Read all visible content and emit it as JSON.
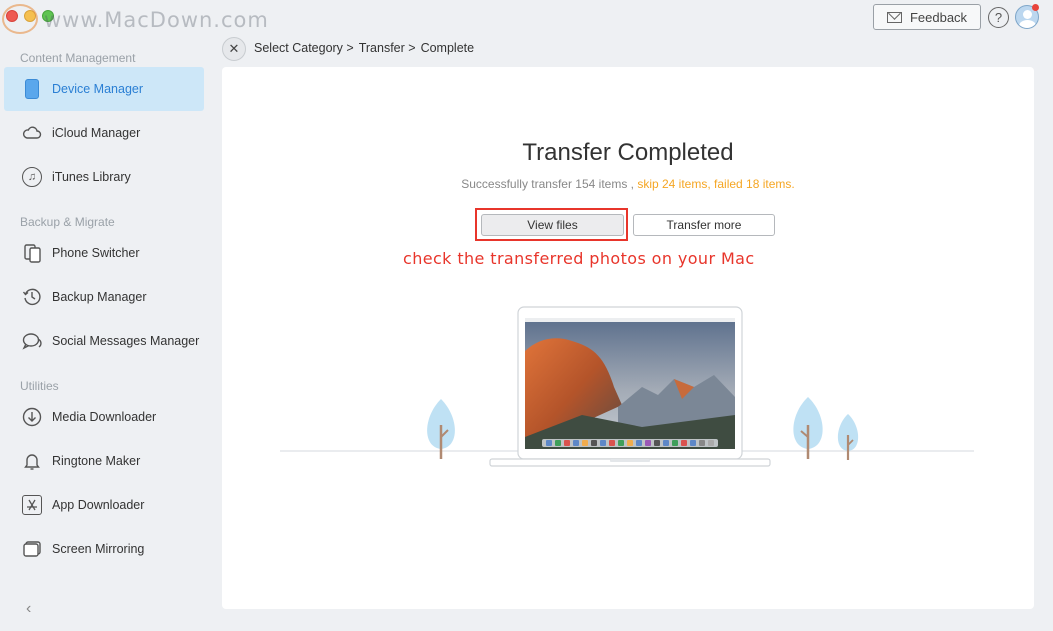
{
  "watermark": "www.MacDown.com",
  "header": {
    "feedback_label": "Feedback",
    "help_label": "?"
  },
  "sidebar": {
    "sections": [
      {
        "label": "Content Management",
        "items": [
          {
            "label": "Device Manager",
            "icon": "phone-icon",
            "active": true
          },
          {
            "label": "iCloud Manager",
            "icon": "cloud-icon"
          },
          {
            "label": "iTunes Library",
            "icon": "music-note-icon"
          }
        ]
      },
      {
        "label": "Backup & Migrate",
        "items": [
          {
            "label": "Phone Switcher",
            "icon": "phone-switch-icon"
          },
          {
            "label": "Backup Manager",
            "icon": "history-clock-icon"
          },
          {
            "label": "Social Messages Manager",
            "icon": "chat-bubbles-icon"
          }
        ]
      },
      {
        "label": "Utilities",
        "items": [
          {
            "label": "Media Downloader",
            "icon": "download-arrow-icon"
          },
          {
            "label": "Ringtone Maker",
            "icon": "bell-icon"
          },
          {
            "label": "App Downloader",
            "icon": "app-store-icon"
          },
          {
            "label": "Screen Mirroring",
            "icon": "screen-mirror-icon"
          }
        ]
      }
    ],
    "collapse_icon": "chevron-left-icon"
  },
  "breadcrumb": {
    "items": [
      "Select Category >",
      "Transfer >",
      "Complete"
    ]
  },
  "main": {
    "title": "Transfer Completed",
    "summary_prefix": "Successfully transfer 154 items ,",
    "summary_skip": "skip 24 items,",
    "summary_failed": "failed 18 items.",
    "view_files_label": "View files",
    "transfer_more_label": "Transfer more",
    "annotation": "check the transferred photos on your Mac"
  },
  "colors": {
    "accent": "#2a7fd4",
    "active_bg": "#cde7f8",
    "warning": "#f5a623",
    "annotation_red": "#e8352b"
  }
}
